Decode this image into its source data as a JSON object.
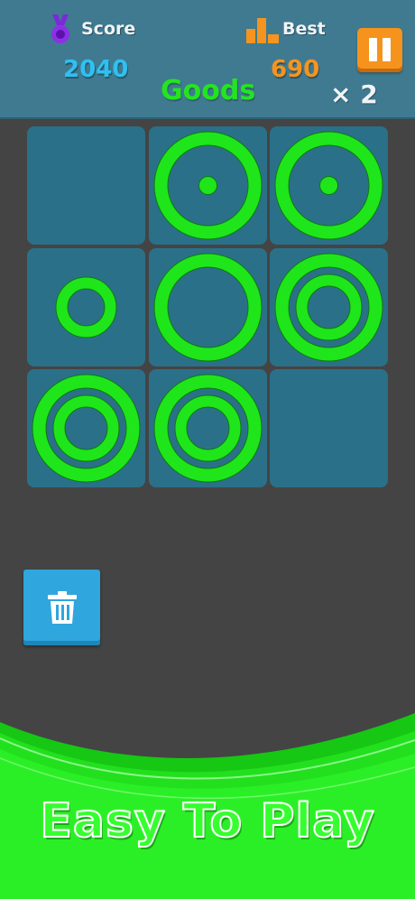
{
  "header": {
    "score_label": "Score",
    "score_value": "2040",
    "best_label": "Best",
    "best_value": "690",
    "feedback": "Goods",
    "multiplier": "× 2"
  },
  "colors": {
    "ring": "#1fe61a",
    "ring_edge": "#0d7a10",
    "cell": "#2b7089",
    "header": "#3f7a91",
    "score": "#2fc0f2",
    "best": "#f5941e"
  },
  "board": {
    "rows": 3,
    "cols": 3,
    "cells": [
      {
        "pieces": []
      },
      {
        "pieces": [
          "large-ring",
          "dot"
        ]
      },
      {
        "pieces": [
          "large-ring",
          "dot"
        ]
      },
      {
        "pieces": [
          "small-ring"
        ]
      },
      {
        "pieces": [
          "large-ring"
        ]
      },
      {
        "pieces": [
          "large-ring",
          "medium-ring"
        ]
      },
      {
        "pieces": [
          "large-ring",
          "medium-ring"
        ]
      },
      {
        "pieces": [
          "large-ring",
          "medium-ring"
        ]
      },
      {
        "pieces": []
      }
    ]
  },
  "icons": {
    "score": "medal-icon",
    "best": "bar-chart-icon",
    "pause": "pause-icon",
    "trash": "trash-icon"
  },
  "banner": {
    "text": "Easy To Play"
  }
}
